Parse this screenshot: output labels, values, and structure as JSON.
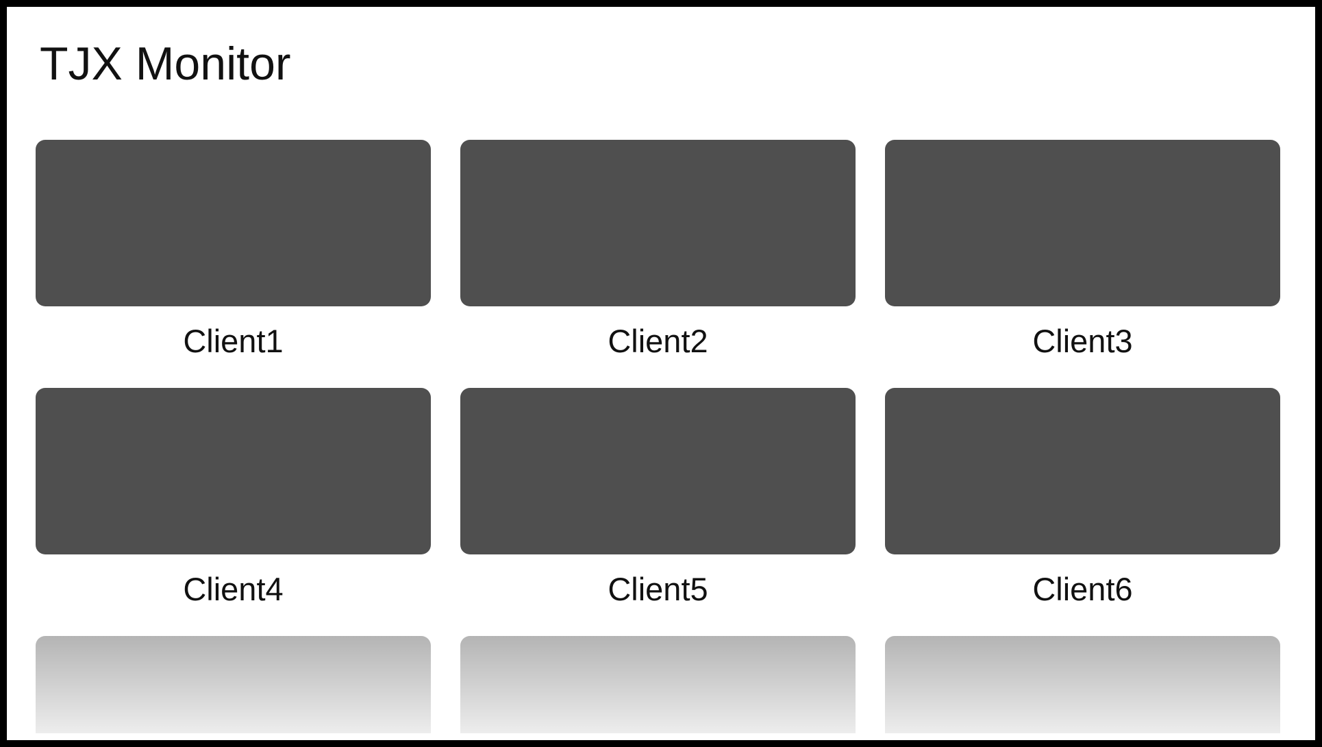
{
  "app": {
    "title": "TJX Monitor"
  },
  "colors": {
    "page_background": "#ffffff",
    "frame_border": "#000000",
    "tile_screen": "#4f4f4f",
    "faded_tile_top": "#b4b4b4",
    "faded_tile_bottom": "#ededed",
    "text": "#111111"
  },
  "clients": [
    {
      "label": "Client1"
    },
    {
      "label": "Client2"
    },
    {
      "label": "Client3"
    },
    {
      "label": "Client4"
    },
    {
      "label": "Client5"
    },
    {
      "label": "Client6"
    }
  ],
  "faded_tile_count": 3
}
